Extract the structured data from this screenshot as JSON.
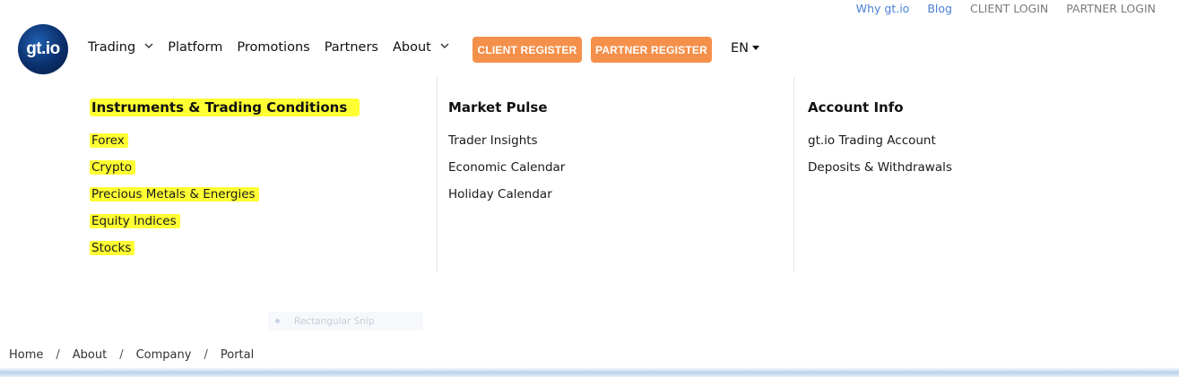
{
  "top_links": {
    "why": "Why gt.io",
    "blog": "Blog",
    "client_login": "CLIENT LOGIN",
    "partner_login": "PARTNER LOGIN"
  },
  "logo": {
    "text": "gt.io"
  },
  "nav": {
    "trading": "Trading",
    "platform": "Platform",
    "promotions": "Promotions",
    "partners": "Partners",
    "about": "About"
  },
  "buttons": {
    "client_register": "CLIENT REGISTER",
    "partner_register": "PARTNER REGISTER"
  },
  "language": "EN",
  "menu": {
    "col1": {
      "title": "Instruments & Trading Conditions",
      "items": [
        "Forex",
        "Crypto",
        "Precious Metals & Energies",
        "Equity Indices",
        "Stocks"
      ]
    },
    "col2": {
      "title": "Market Pulse",
      "items": [
        "Trader Insights",
        "Economic Calendar",
        "Holiday Calendar"
      ]
    },
    "col3": {
      "title": "Account Info",
      "items": [
        "gt.io Trading Account",
        "Deposits & Withdrawals"
      ]
    }
  },
  "snip_tooltip": "Rectangular Snip",
  "breadcrumb": [
    "Home",
    "About",
    "Company",
    "Portal"
  ],
  "breadcrumb_separator": "/",
  "colors": {
    "accent_orange": "#f5904b",
    "link_blue": "#4a7fd6",
    "highlight_yellow": "#ffff33",
    "logo_navy": "#0b2f6b"
  }
}
